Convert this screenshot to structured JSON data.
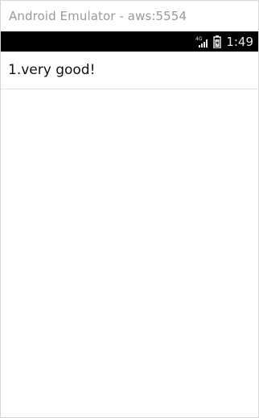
{
  "window": {
    "title": "Android Emulator - aws:5554"
  },
  "status_bar": {
    "network_label": "4G",
    "time": "1:49",
    "icons": [
      "signal-icon",
      "battery-icon"
    ]
  },
  "list": {
    "items": [
      {
        "label": "1.very good!"
      }
    ]
  },
  "colors": {
    "status_bar_bg": "#000000",
    "divider": "#e3e3e3",
    "title_text": "#9a9a9a"
  }
}
